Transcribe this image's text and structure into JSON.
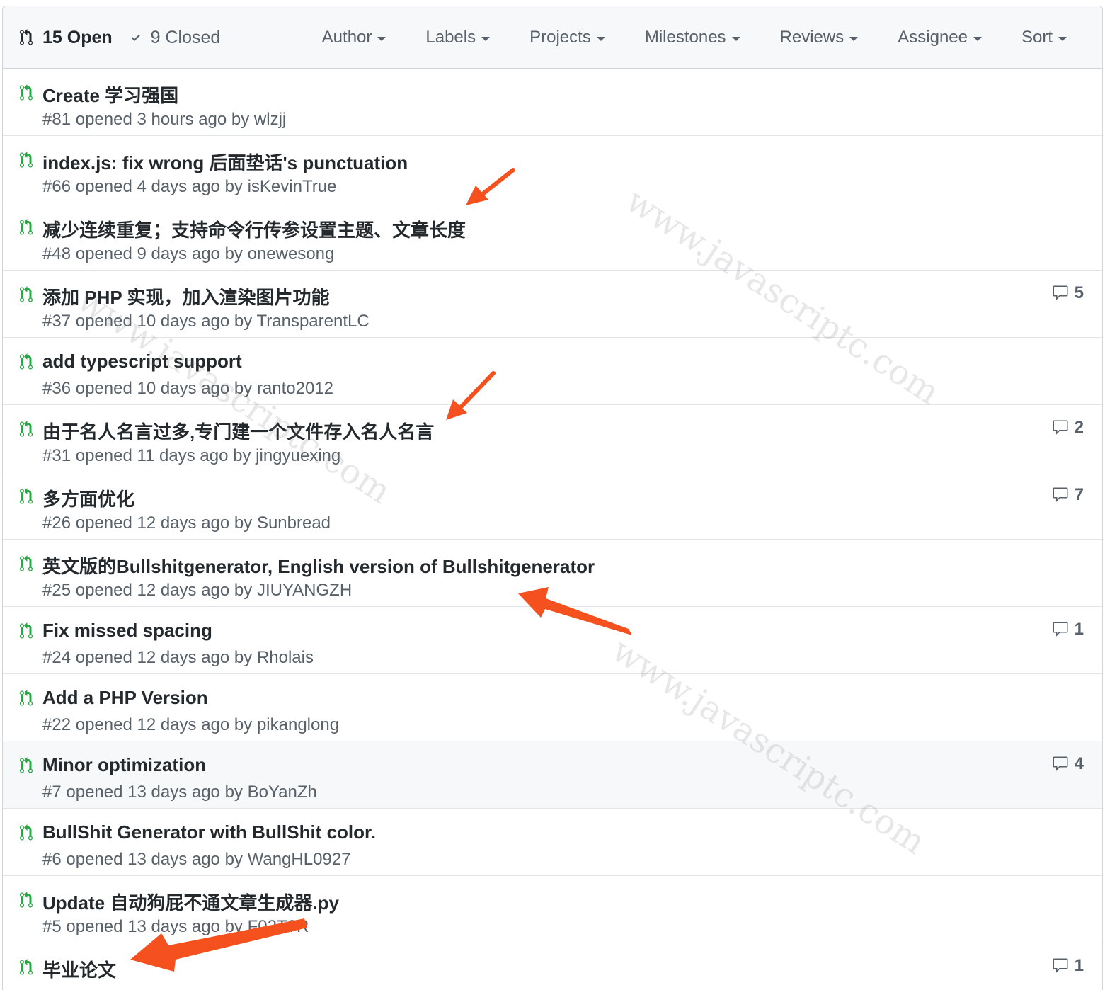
{
  "header": {
    "open_label": "15 Open",
    "closed_label": "9 Closed",
    "filters": [
      "Author",
      "Labels",
      "Projects",
      "Milestones",
      "Reviews",
      "Assignee",
      "Sort"
    ]
  },
  "pulls": [
    {
      "title": "Create 学习强国",
      "number": "#81",
      "opened": "opened 3 hours ago by",
      "author": "wlzjj",
      "comments": ""
    },
    {
      "title": "index.js: fix wrong 后面垫话's punctuation",
      "number": "#66",
      "opened": "opened 4 days ago by",
      "author": "isKevinTrue",
      "comments": ""
    },
    {
      "title": "减少连续重复；支持命令行传参设置主题、文章长度",
      "number": "#48",
      "opened": "opened 9 days ago by",
      "author": "onewesong",
      "comments": ""
    },
    {
      "title": "添加 PHP 实现，加入渲染图片功能",
      "number": "#37",
      "opened": "opened 10 days ago by",
      "author": "TransparentLC",
      "comments": "5"
    },
    {
      "title": "add typescript support",
      "number": "#36",
      "opened": "opened 10 days ago by",
      "author": "ranto2012",
      "comments": ""
    },
    {
      "title": "由于名人名言过多,专门建一个文件存入名人名言",
      "number": "#31",
      "opened": "opened 11 days ago by",
      "author": "jingyuexing",
      "comments": "2"
    },
    {
      "title": "多方面优化",
      "number": "#26",
      "opened": "opened 12 days ago by",
      "author": "Sunbread",
      "comments": "7"
    },
    {
      "title": "英文版的Bullshitgenerator, English version of Bullshitgenerator",
      "number": "#25",
      "opened": "opened 12 days ago by",
      "author": "JIUYANGZH",
      "comments": ""
    },
    {
      "title": "Fix missed spacing",
      "number": "#24",
      "opened": "opened 12 days ago by",
      "author": "Rholais",
      "comments": "1"
    },
    {
      "title": "Add a PHP Version",
      "number": "#22",
      "opened": "opened 12 days ago by",
      "author": "pikanglong",
      "comments": ""
    },
    {
      "title": "Minor optimization",
      "number": "#7",
      "opened": "opened 13 days ago by",
      "author": "BoYanZh",
      "comments": "4"
    },
    {
      "title": "BullShit Generator with BullShit color.",
      "number": "#6",
      "opened": "opened 13 days ago by",
      "author": "WangHL0927",
      "comments": ""
    },
    {
      "title": "Update 自动狗屁不通文章生成器.py",
      "number": "#5",
      "opened": "opened 13 days ago by",
      "author": "F02T?R",
      "comments": ""
    },
    {
      "title": "毕业论文",
      "number": "",
      "opened": "",
      "author": "",
      "comments": "1"
    }
  ],
  "watermark_text": "www.javascriptc.com",
  "colors": {
    "pr_open": "#28a745",
    "annotation_arrow": "#f4511e"
  },
  "icons": {
    "pull_request": "git-pull-request-icon",
    "check": "check-icon",
    "comment": "comment-icon"
  }
}
